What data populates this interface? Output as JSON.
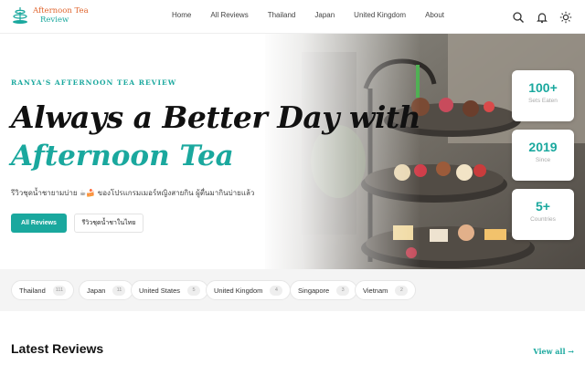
{
  "brand": {
    "line1": "Afternoon Tea",
    "line2": "Review",
    "logo_icon": "teapot-tiered-stand-icon",
    "accent": "#1aa89e",
    "accent_warm": "#e0662f"
  },
  "nav": {
    "items": [
      "Home",
      "All Reviews",
      "Thailand",
      "Japan",
      "United Kingdom",
      "About"
    ]
  },
  "header_icons": [
    "search-icon",
    "bell-icon",
    "sun-icon"
  ],
  "hero": {
    "eyebrow": "RANYA'S AFTERNOON TEA REVIEW",
    "title_line1": "Always a Better Day with",
    "title_line2": "Afternoon Tea",
    "subtitle": "รีวิวชุดน้ำชายามบ่าย ☕🍰 ของโปรแกรมเมอร์หญิงสายกิน ผู้ตื่นมากินบ่ายแล้ว",
    "primary_button": "All Reviews",
    "secondary_button": "รีวิวชุดน้ำชาในไทย",
    "stats": [
      {
        "value": "100+",
        "label": "Sets Eaten"
      },
      {
        "value": "2019",
        "label": "Since"
      },
      {
        "value": "5+",
        "label": "Countries"
      }
    ]
  },
  "countries": [
    {
      "name": "Thailand",
      "count": "111"
    },
    {
      "name": "Japan",
      "count": "11"
    },
    {
      "name": "United States",
      "count": "5"
    },
    {
      "name": "United Kingdom",
      "count": "4"
    },
    {
      "name": "Singapore",
      "count": "3"
    },
    {
      "name": "Vietnam",
      "count": "2"
    }
  ],
  "latest": {
    "title": "Latest Reviews",
    "view_all": "View all →"
  }
}
